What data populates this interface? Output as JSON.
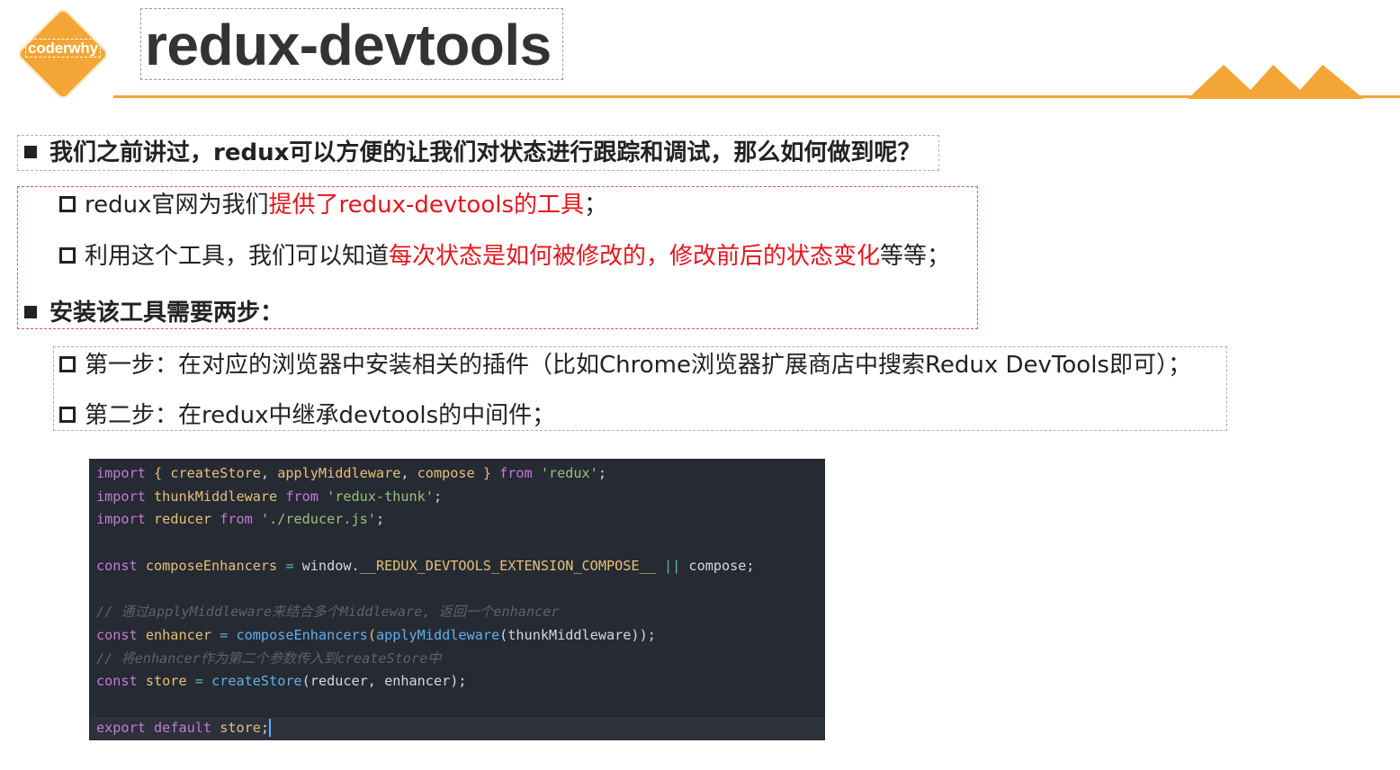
{
  "logo": {
    "text": "coderwhy"
  },
  "title": "redux-devtools",
  "colors": {
    "accent": "#f3a535",
    "highlight": "#e8141b",
    "code_bg": "#262a32"
  },
  "bullets": [
    {
      "level": 1,
      "text": "我们之前讲过，redux可以方便的让我们对状态进行跟踪和调试，那么如何做到呢？"
    },
    {
      "level": 2,
      "before": "redux官网为我们",
      "highlight": "提供了redux-devtools的工具",
      "after": "；"
    },
    {
      "level": 2,
      "before": "利用这个工具，我们可以知道",
      "highlight": "每次状态是如何被修改的，修改前后的状态变化",
      "after": "等等；"
    },
    {
      "level": 1,
      "text": "安装该工具需要两步："
    },
    {
      "level": 2,
      "text": "第一步：在对应的浏览器中安装相关的插件（比如Chrome浏览器扩展商店中搜索Redux DevTools即可）；"
    },
    {
      "level": 2,
      "text": "第二步：在redux中继承devtools的中间件；"
    }
  ],
  "code": {
    "l1": {
      "k1": "import",
      "p1": " { ",
      "v1": "createStore",
      "p2": ", ",
      "v2": "applyMiddleware",
      "p3": ", ",
      "v3": "compose",
      "p4": " } ",
      "k2": "from",
      "p5": " ",
      "s1": "'redux'",
      "p6": ";"
    },
    "l2": {
      "k1": "import",
      "p1": " ",
      "v1": "thunkMiddleware",
      "p2": " ",
      "k2": "from",
      "p3": " ",
      "s1": "'redux-thunk'",
      "p4": ";"
    },
    "l3": {
      "k1": "import",
      "p1": " ",
      "v1": "reducer",
      "p2": " ",
      "k2": "from",
      "p3": " ",
      "s1": "'./reducer.js'",
      "p4": ";"
    },
    "l5": {
      "k1": "const",
      "p1": " ",
      "v1": "composeEnhancers",
      "p2": " ",
      "o1": "=",
      "p3": " window.",
      "v2": "__REDUX_DEVTOOLS_EXTENSION_COMPOSE__",
      "p4": " ",
      "o2": "||",
      "p5": " compose;"
    },
    "l7": "// 通过applyMiddleware来结合多个Middleware, 返回一个enhancer",
    "l8": {
      "k1": "const",
      "p1": " ",
      "v1": "enhancer",
      "p2": " ",
      "o1": "=",
      "p3": " ",
      "f1": "composeEnhancers",
      "p4": "(",
      "f2": "applyMiddleware",
      "p5": "(thunkMiddleware));"
    },
    "l9": "// 将enhancer作为第二个参数传入到createStore中",
    "l10": {
      "k1": "const",
      "p1": " ",
      "v1": "store",
      "p2": " ",
      "o1": "=",
      "p3": " ",
      "f1": "createStore",
      "p4": "(reducer, enhancer);"
    },
    "l12": {
      "k1": "export",
      "p1": " ",
      "k2": "default",
      "p2": " ",
      "v1": "store",
      "p3": ";"
    }
  }
}
